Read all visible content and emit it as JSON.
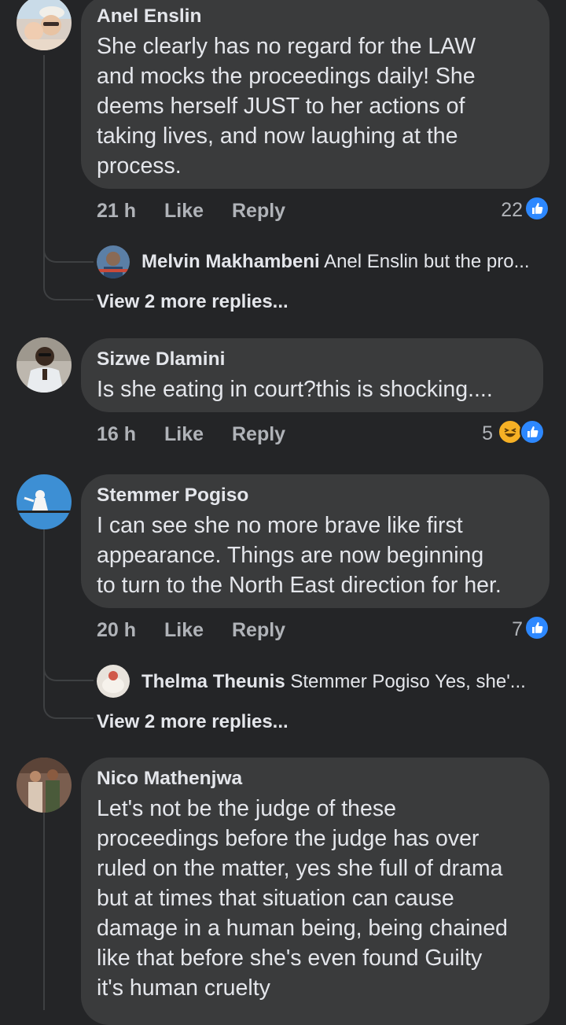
{
  "comments": [
    {
      "author": "Anel Enslin",
      "text": "She clearly has no regard for the LAW\nand mocks the proceedings daily! She\ndeems herself JUST to her actions of\ntaking lives, and now laughing at the\nprocess.",
      "time": "21 h",
      "like_label": "Like",
      "reply_label": "Reply",
      "reaction_count": "22",
      "reactions": [
        "like-icon"
      ],
      "reply_preview": {
        "author": "Melvin Makhambeni",
        "text": "Anel Enslin but the pro..."
      },
      "view_more": "View 2 more replies..."
    },
    {
      "author": "Sizwe Dlamini",
      "text": "Is she eating in court?this is shocking....",
      "time": "16 h",
      "like_label": "Like",
      "reply_label": "Reply",
      "reaction_count": "5",
      "reactions": [
        "haha-icon",
        "like-icon"
      ]
    },
    {
      "author": "Stemmer Pogiso",
      "text": "I can see she no more brave like first\nappearance. Things are now beginning\nto turn to the North East direction for her.",
      "time": "20 h",
      "like_label": "Like",
      "reply_label": "Reply",
      "reaction_count": "7",
      "reactions": [
        "like-icon"
      ],
      "reply_preview": {
        "author": "Thelma Theunis",
        "text": "Stemmer Pogiso  Yes, she'..."
      },
      "view_more": "View 2 more replies..."
    },
    {
      "author": "Nico Mathenjwa",
      "text": "Let's not be the judge of these\nproceedings before the judge has over\nruled on the matter, yes she full of drama\nbut at times that situation can cause\ndamage in a human being, being chained\nlike that before she's even found Guilty\nit's human cruelty"
    }
  ],
  "colors": {
    "background": "#242527",
    "bubble": "#3a3b3c",
    "text_primary": "#e4e6eb",
    "text_secondary": "#b0b3b8",
    "like_blue": "#2d88ff",
    "haha_yellow": "#f7b125"
  }
}
